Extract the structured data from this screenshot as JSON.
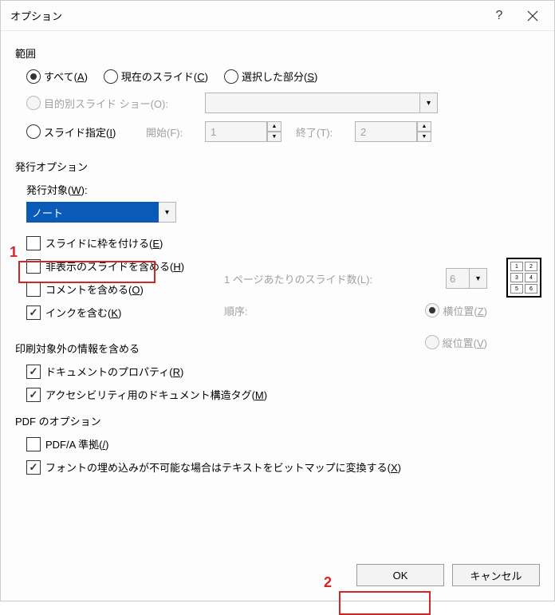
{
  "titlebar": {
    "title": "オプション"
  },
  "annotations": {
    "marker1": "1",
    "marker2": "2"
  },
  "range": {
    "section_title": "範囲",
    "all": "すべて(",
    "all_u": "A",
    "all_end": ")",
    "current": "現在のスライド(",
    "current_u": "C",
    "current_end": ")",
    "selected": "選択した部分(",
    "selected_u": "S",
    "selected_end": ")",
    "custom_show": "目的別スライド ショー(O):",
    "slide_spec": "スライド指定(",
    "slide_spec_u": "I",
    "slide_spec_end": ")",
    "from_label": "開始(F):",
    "from_value": "1",
    "to_label": "終了(T):",
    "to_value": "2"
  },
  "publish": {
    "section_title": "発行オプション",
    "target_label_pre": "発行対象(",
    "target_label_u": "W",
    "target_label_end": "):",
    "target_value": "ノート",
    "frame_pre": "スライドに枠を付ける(",
    "frame_u": "E",
    "frame_end": ")",
    "hidden_pre": "非表示のスライドを含める(",
    "hidden_u": "H",
    "hidden_end": ")",
    "comments_pre": "コメントを含める(",
    "comments_u": "O",
    "comments_end": ")",
    "ink_pre": "インクを含む(",
    "ink_u": "K",
    "ink_end": ")",
    "slides_per_page_label": "1 ページあたりのスライド数(L):",
    "slides_per_page_value": "6",
    "order_label": "順序:",
    "horiz_pre": "横位置(",
    "horiz_u": "Z",
    "horiz_end": ")",
    "vert_pre": "縦位置(",
    "vert_u": "V",
    "vert_end": ")",
    "preview": {
      "c1": "1",
      "c2": "2",
      "c3": "3",
      "c4": "4",
      "c5": "5",
      "c6": "6"
    }
  },
  "nonprint": {
    "section_title": "印刷対象外の情報を含める",
    "docprops_pre": "ドキュメントのプロパティ(",
    "docprops_u": "R",
    "docprops_end": ")",
    "accessibility_pre": "アクセシビリティ用のドキュメント構造タグ(",
    "accessibility_u": "M",
    "accessibility_end": ")"
  },
  "pdf": {
    "section_title": "PDF のオプション",
    "pdfa_pre": "PDF/A 準拠(",
    "pdfa_u": "/",
    "pdfa_end": ")",
    "bitmap_pre": "フォントの埋め込みが不可能な場合はテキストをビットマップに変換する(",
    "bitmap_u": "X",
    "bitmap_end": ")"
  },
  "buttons": {
    "ok": "OK",
    "cancel": "キャンセル"
  }
}
